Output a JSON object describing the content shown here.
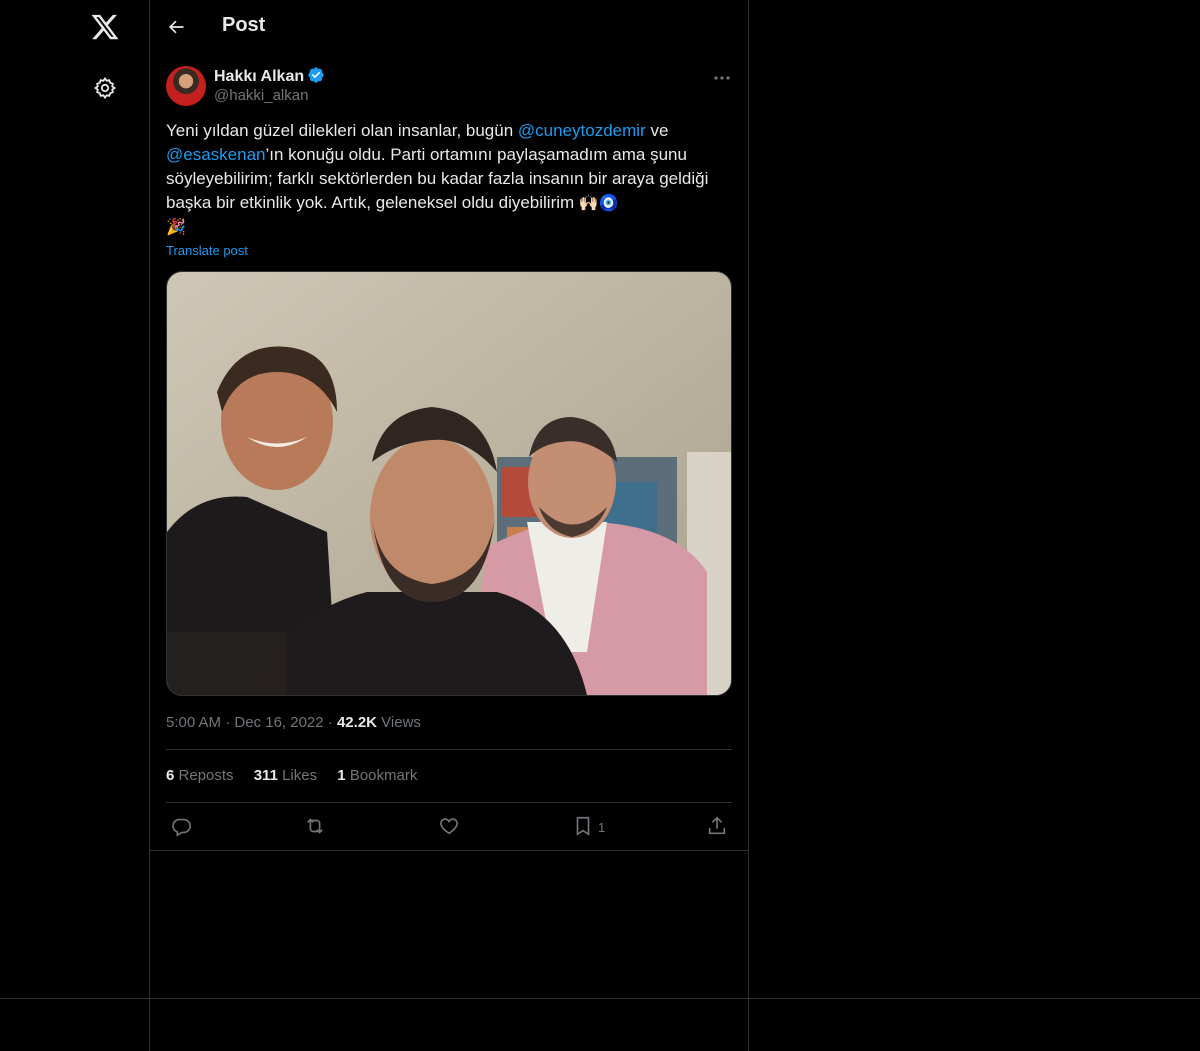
{
  "nav": {
    "logo_icon": "x-logo-icon",
    "settings_icon": "gear-icon"
  },
  "header": {
    "title": "Post"
  },
  "author": {
    "name": "Hakkı Alkan",
    "handle": "@hakki_alkan"
  },
  "post": {
    "text_1": "Yeni yıldan güzel dilekleri olan insanlar, bugün ",
    "mention_1": "@cuneytozdemir",
    "text_2": " ve ",
    "mention_2": "@esaskenan",
    "text_3": "’ın konuğu oldu. Parti ortamını paylaşamadım ama şunu söyleyebilirim; farklı sektörlerden bu kadar fazla insanın bir araya geldiği başka bir etkinlik yok. Artık, geleneksel oldu diyebilirim ",
    "emoji_1": "🙌🏻",
    "emoji_2": "🧿",
    "emoji_3": "🎉",
    "translate_label": "Translate post"
  },
  "meta": {
    "time": "5:00 AM",
    "dot": "·",
    "date": "Dec 16, 2022",
    "views_count": "42.2K",
    "views_label": "Views"
  },
  "stats": {
    "reposts_count": "6",
    "reposts_label": "Reposts",
    "likes_count": "311",
    "likes_label": "Likes",
    "bookmarks_count": "1",
    "bookmarks_label": "Bookmark"
  },
  "actions": {
    "bookmark_count": "1"
  },
  "colors": {
    "accent": "#1d9bf0",
    "muted": "#71767b",
    "border": "#2f3336",
    "text": "#e7e9ea"
  }
}
